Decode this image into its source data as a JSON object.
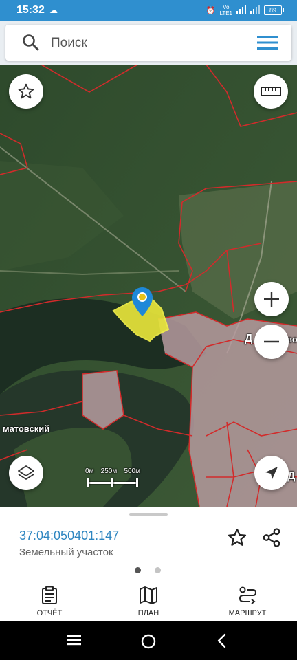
{
  "status_bar": {
    "time": "15:32",
    "network_top": "Vo",
    "network_bottom": "LTE1",
    "signal1": "4G",
    "signal2": "4G",
    "battery": "89"
  },
  "search": {
    "placeholder": "Поиск"
  },
  "map": {
    "labels": {
      "left_place": "матовский",
      "right_place_1": "Д",
      "right_place_1_suffix": "во",
      "right_place_2": "Д"
    },
    "scale": {
      "labels": [
        "0м",
        "250м",
        "500м"
      ]
    },
    "colors": {
      "parcel_fill": "#e6e43a",
      "boundary": "#d22b2b",
      "marker": "#1e88d8"
    }
  },
  "parcel": {
    "number": "37:04:050401:147",
    "type": "Земельный участок"
  },
  "pager": {
    "active": 0,
    "count": 2
  },
  "bottom_nav": {
    "report": "ОТЧЁТ",
    "plan": "ПЛАН",
    "route": "МАРШРУТ"
  }
}
